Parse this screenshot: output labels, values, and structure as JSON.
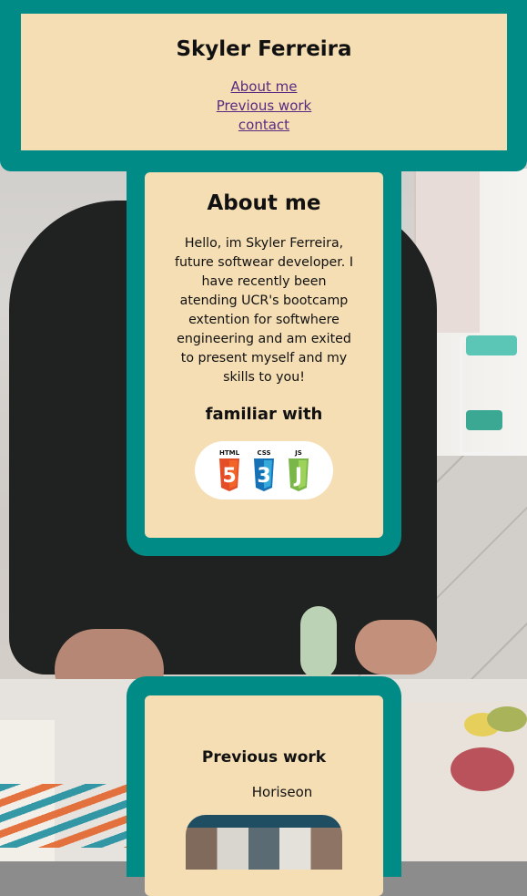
{
  "header": {
    "title": "Skyler Ferreira",
    "nav": [
      {
        "label": "About me"
      },
      {
        "label": "Previous work"
      },
      {
        "label": "contact"
      }
    ]
  },
  "about": {
    "title": "About me",
    "text": "Hello, im Skyler Ferreira, future softwear developer. I have recently been atending UCR's bootcamp extention for softwhere engineering and am exited to present myself and my skills to you!",
    "familiar_title": "familiar with",
    "skills": [
      {
        "label": "HTML",
        "number": "5",
        "color": "#e44d26",
        "icon": "html5-icon"
      },
      {
        "label": "CSS",
        "number": "3",
        "color": "#2965f1",
        "icon": "css3-icon"
      },
      {
        "label": "JS",
        "number": "J",
        "color": "#8cc84b",
        "icon": "js-icon"
      }
    ]
  },
  "work": {
    "title": "Previous work",
    "projects": [
      {
        "name": "Horiseon"
      }
    ]
  },
  "colors": {
    "frame": "#008b87",
    "card": "#f5deb3",
    "link": "#5a2a82"
  }
}
